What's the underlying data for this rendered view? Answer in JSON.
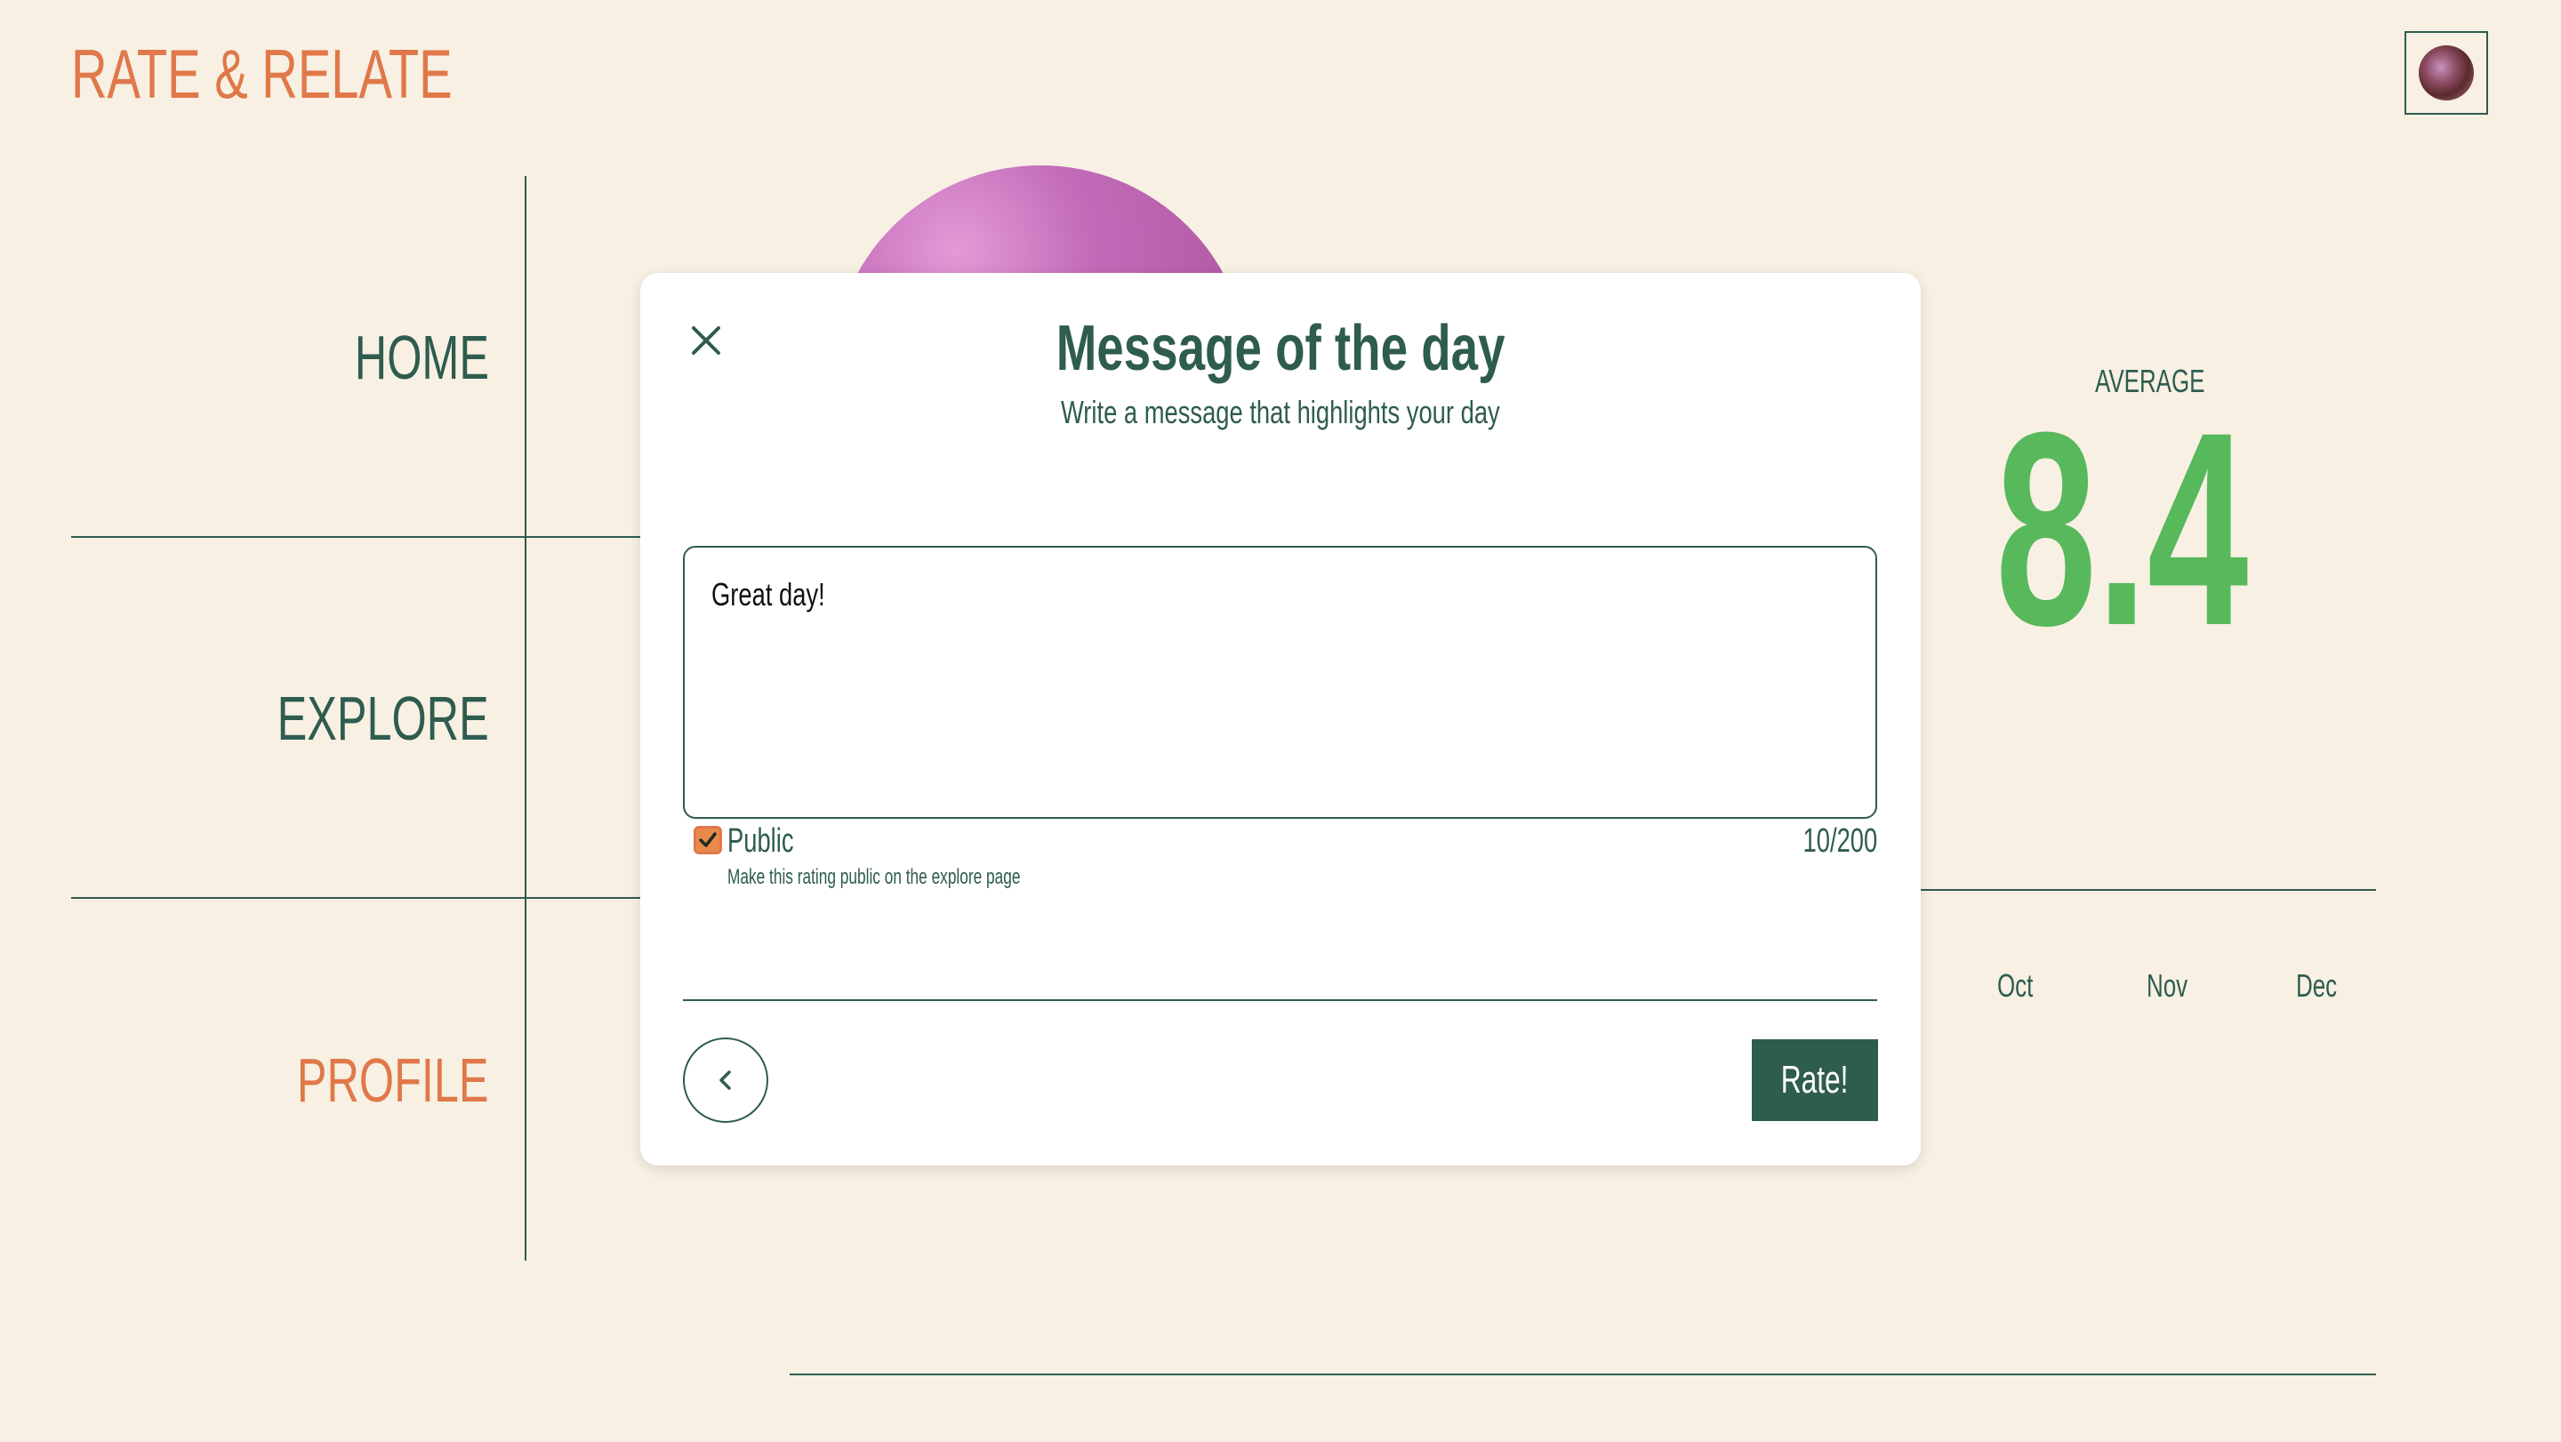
{
  "app": {
    "title": "RATE & RELATE"
  },
  "header": {
    "avatar_icon": "user-avatar"
  },
  "nav": {
    "items": [
      {
        "label": "HOME",
        "active": false
      },
      {
        "label": "EXPLORE",
        "active": false
      },
      {
        "label": "PROFILE",
        "active": true
      }
    ]
  },
  "stats": {
    "average_label": "AVERAGE",
    "average_value": "8.4",
    "months": [
      "Oct",
      "Nov",
      "Dec"
    ]
  },
  "modal": {
    "close_icon": "close-icon",
    "title": "Message of the day",
    "subtitle": "Write a message that highlights your day",
    "message_value": "Great day!",
    "public_checked": true,
    "public_label": "Public",
    "public_help": "Make this rating public on the explore page",
    "counter": "10/200",
    "back_icon": "chevron-left-icon",
    "submit_label": "Rate!"
  },
  "colors": {
    "background": "#f7f0e3",
    "primary": "#2e5c4f",
    "accent": "#e0784a",
    "highlight": "#58b85c"
  }
}
